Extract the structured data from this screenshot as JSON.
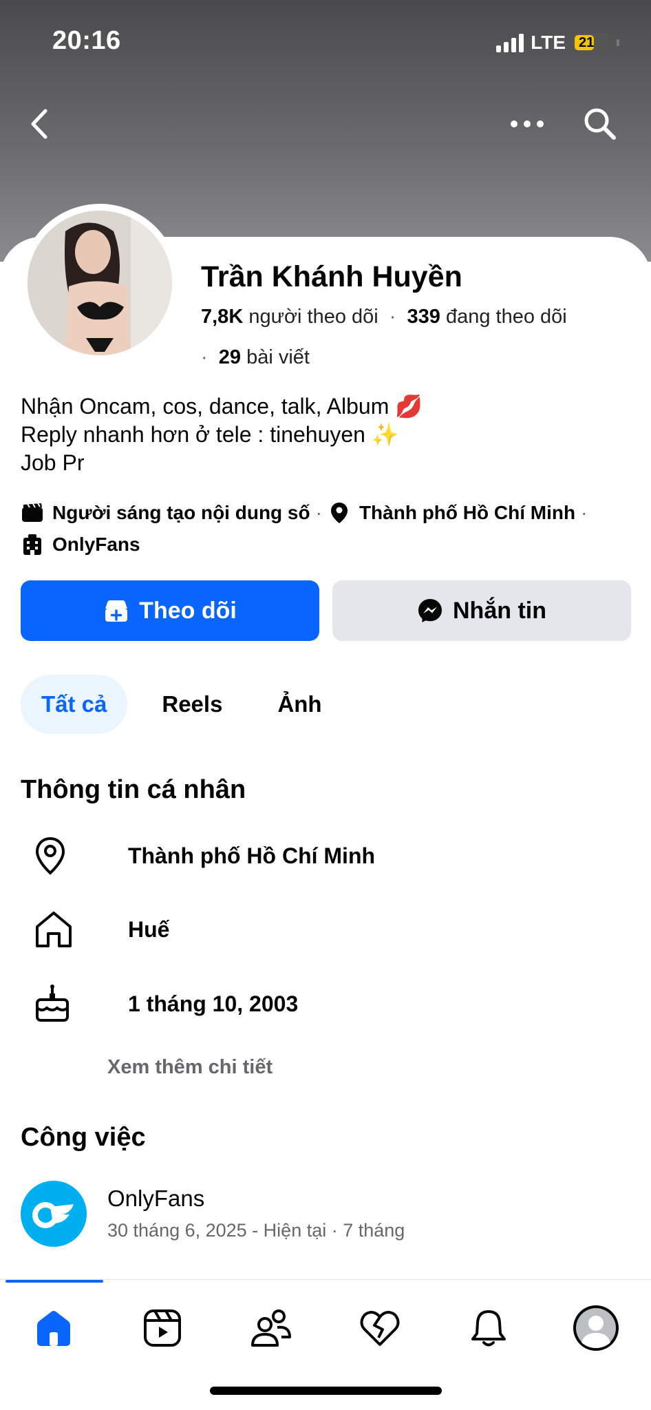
{
  "status": {
    "time": "20:16",
    "network": "LTE",
    "battery": "21"
  },
  "header": {
    "back_icon": "chevron-left-icon",
    "more_icon": "more-horizontal-icon",
    "search_icon": "search-icon"
  },
  "profile": {
    "name": "Trần Khánh Huyền",
    "followers_count": "7,8K",
    "followers_label": "người theo dõi",
    "following_count": "339",
    "following_label": "đang theo dõi",
    "posts_count": "29",
    "posts_label": "bài viết",
    "separator": "·"
  },
  "bio": {
    "line1": "Nhận Oncam, cos, dance, talk, Album 💋",
    "line2": "Reply nhanh hơn ở tele : tinehuyen ✨",
    "line3": "Job Pr"
  },
  "meta": {
    "category": "Người sáng tạo nội dung số",
    "location": "Thành phố Hồ Chí Minh",
    "workplace": "OnlyFans"
  },
  "actions": {
    "follow": "Theo dõi",
    "message": "Nhắn tin"
  },
  "tabs": [
    {
      "label": "Tất cả"
    },
    {
      "label": "Reels"
    },
    {
      "label": "Ảnh"
    }
  ],
  "personal_info": {
    "title": "Thông tin cá nhân",
    "current_city": "Thành phố Hồ Chí Minh",
    "hometown": "Huế",
    "birthday": "1 tháng 10, 2003",
    "see_more": "Xem thêm chi tiết"
  },
  "work": {
    "title": "Công việc",
    "company": "OnlyFans",
    "period": "30 tháng 6, 2025 - Hiện tại · 7 tháng"
  },
  "colors": {
    "accent": "#0866ff",
    "onlyfans": "#00aff0",
    "secondary_button": "#e4e6eb",
    "active_tab_bg": "#ebf5ff"
  }
}
